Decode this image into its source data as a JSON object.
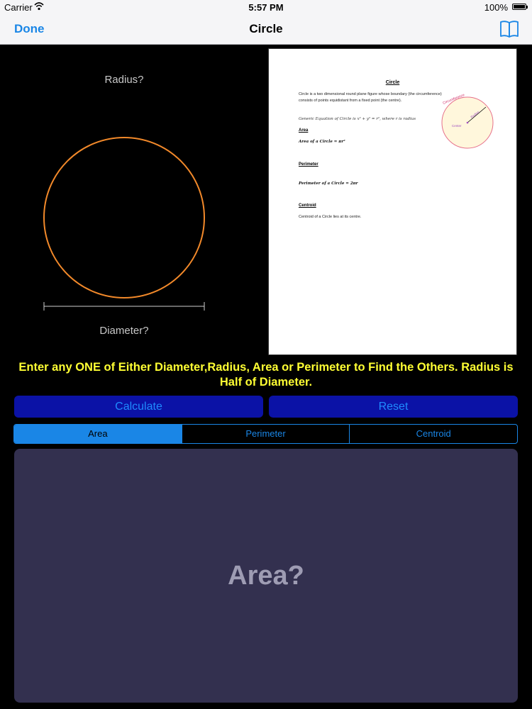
{
  "status_bar": {
    "carrier": "Carrier",
    "time": "5:57 PM",
    "battery": "100%"
  },
  "nav": {
    "done_label": "Done",
    "title": "Circle"
  },
  "diagram": {
    "radius_label": "Radius?",
    "diameter_label": "Diameter?",
    "circle_color": "#f2892a"
  },
  "doc": {
    "title": "Circle",
    "description": "Circle is a two dimensional round plane figure whose boundary (the circumference) consists of points equidistant from a fixed point (the centre).",
    "generic_equation": "Generic Equation of Circle is x² + y² = r², where r is radius",
    "area_heading": "Area",
    "area_formula": "Area of a Circle = πr²",
    "perimeter_heading": "Perimeter",
    "perimeter_formula": "Perimeter of a Circle = 2πr",
    "centroid_heading": "Centroid",
    "centroid_text": "Centroid of a Circle lies at its centre.",
    "figure_labels": {
      "circumference": "Circumference",
      "radius": "Radius",
      "center": "Center"
    }
  },
  "instruction": "Enter any ONE of Either Diameter,Radius, Area or Perimeter to Find the Others. Radius is Half of Diameter.",
  "buttons": {
    "calculate": "Calculate",
    "reset": "Reset"
  },
  "tabs": [
    {
      "label": "Area",
      "active": true
    },
    {
      "label": "Perimeter",
      "active": false
    },
    {
      "label": "Centroid",
      "active": false
    }
  ],
  "result_placeholder": "Area?",
  "colors": {
    "accent": "#1a86e6",
    "instruction": "#ffff33",
    "button_bg": "#0b12a6",
    "panel_bg": "#33304f"
  }
}
